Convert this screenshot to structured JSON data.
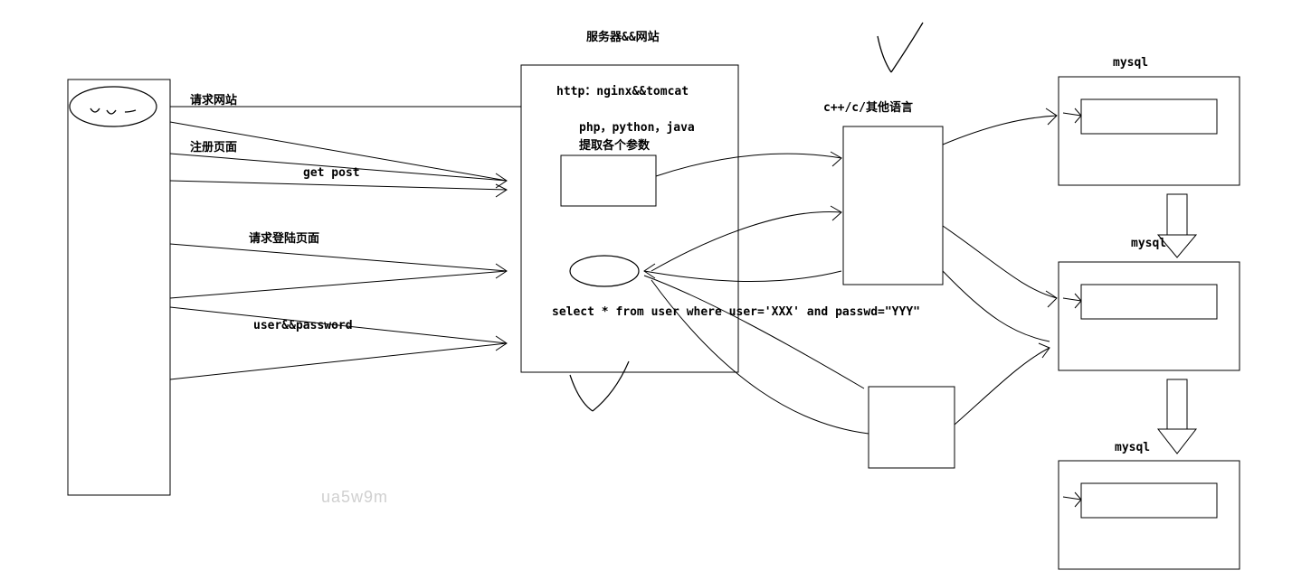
{
  "title": "服务器&&网站",
  "client": {
    "label_request_site": "请求网站",
    "label_register_page": "注册页面",
    "label_get_post": "get post",
    "label_request_login": "请求登陆页面",
    "label_user_password": "user&&password"
  },
  "server": {
    "http_line": "http：nginx&&tomcat",
    "lang_line": "php，python，java",
    "extract_line": "提取各个参数",
    "sql_line": "select * from user where user='XXX' and passwd=\"YYY\""
  },
  "backend": {
    "lang_label": "c++/c/其他语言"
  },
  "db": {
    "label1": "mysql",
    "label2": "mysql",
    "label3": "mysql"
  },
  "watermark": "ua5w9m"
}
